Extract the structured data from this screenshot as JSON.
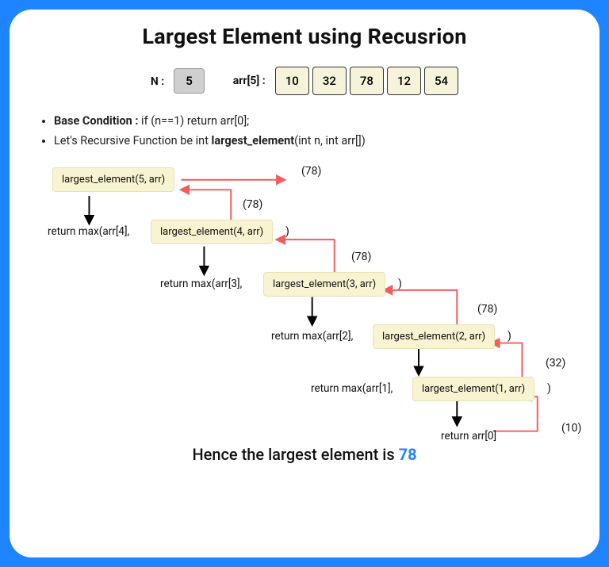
{
  "title": "Largest Element using Recusrion",
  "n_label": "N :",
  "n_value": "5",
  "arr_label": "arr[5] :",
  "arr": [
    "10",
    "32",
    "78",
    "12",
    "54"
  ],
  "bullets": {
    "b1_strong": "Base Condition :",
    "b1_rest": " if (n==1) return arr[0];",
    "b2_pre": "Let's Recursive Function be int ",
    "b2_strong": "largest_element",
    "b2_post": "(int n, int arr[])"
  },
  "calls": {
    "c5": "largest_element(5, arr)",
    "c4": "largest_element(4, arr)",
    "c3": "largest_element(3, arr)",
    "c2": "largest_element(2, arr)",
    "c1": "largest_element(1, arr)"
  },
  "returns": {
    "r4": "return max(arr[4],",
    "r3": "return max(arr[3],",
    "r2": "return max(arr[2],",
    "r1": "return max(arr[1],",
    "r0": "return arr[0]"
  },
  "paren": ")",
  "values": {
    "top": "(78)",
    "v5": "(78)",
    "v4": "(78)",
    "v3": "(78)",
    "v2": "(32)",
    "v1": "(10)"
  },
  "result_text": "Hence the largest element is ",
  "result_value": "78"
}
